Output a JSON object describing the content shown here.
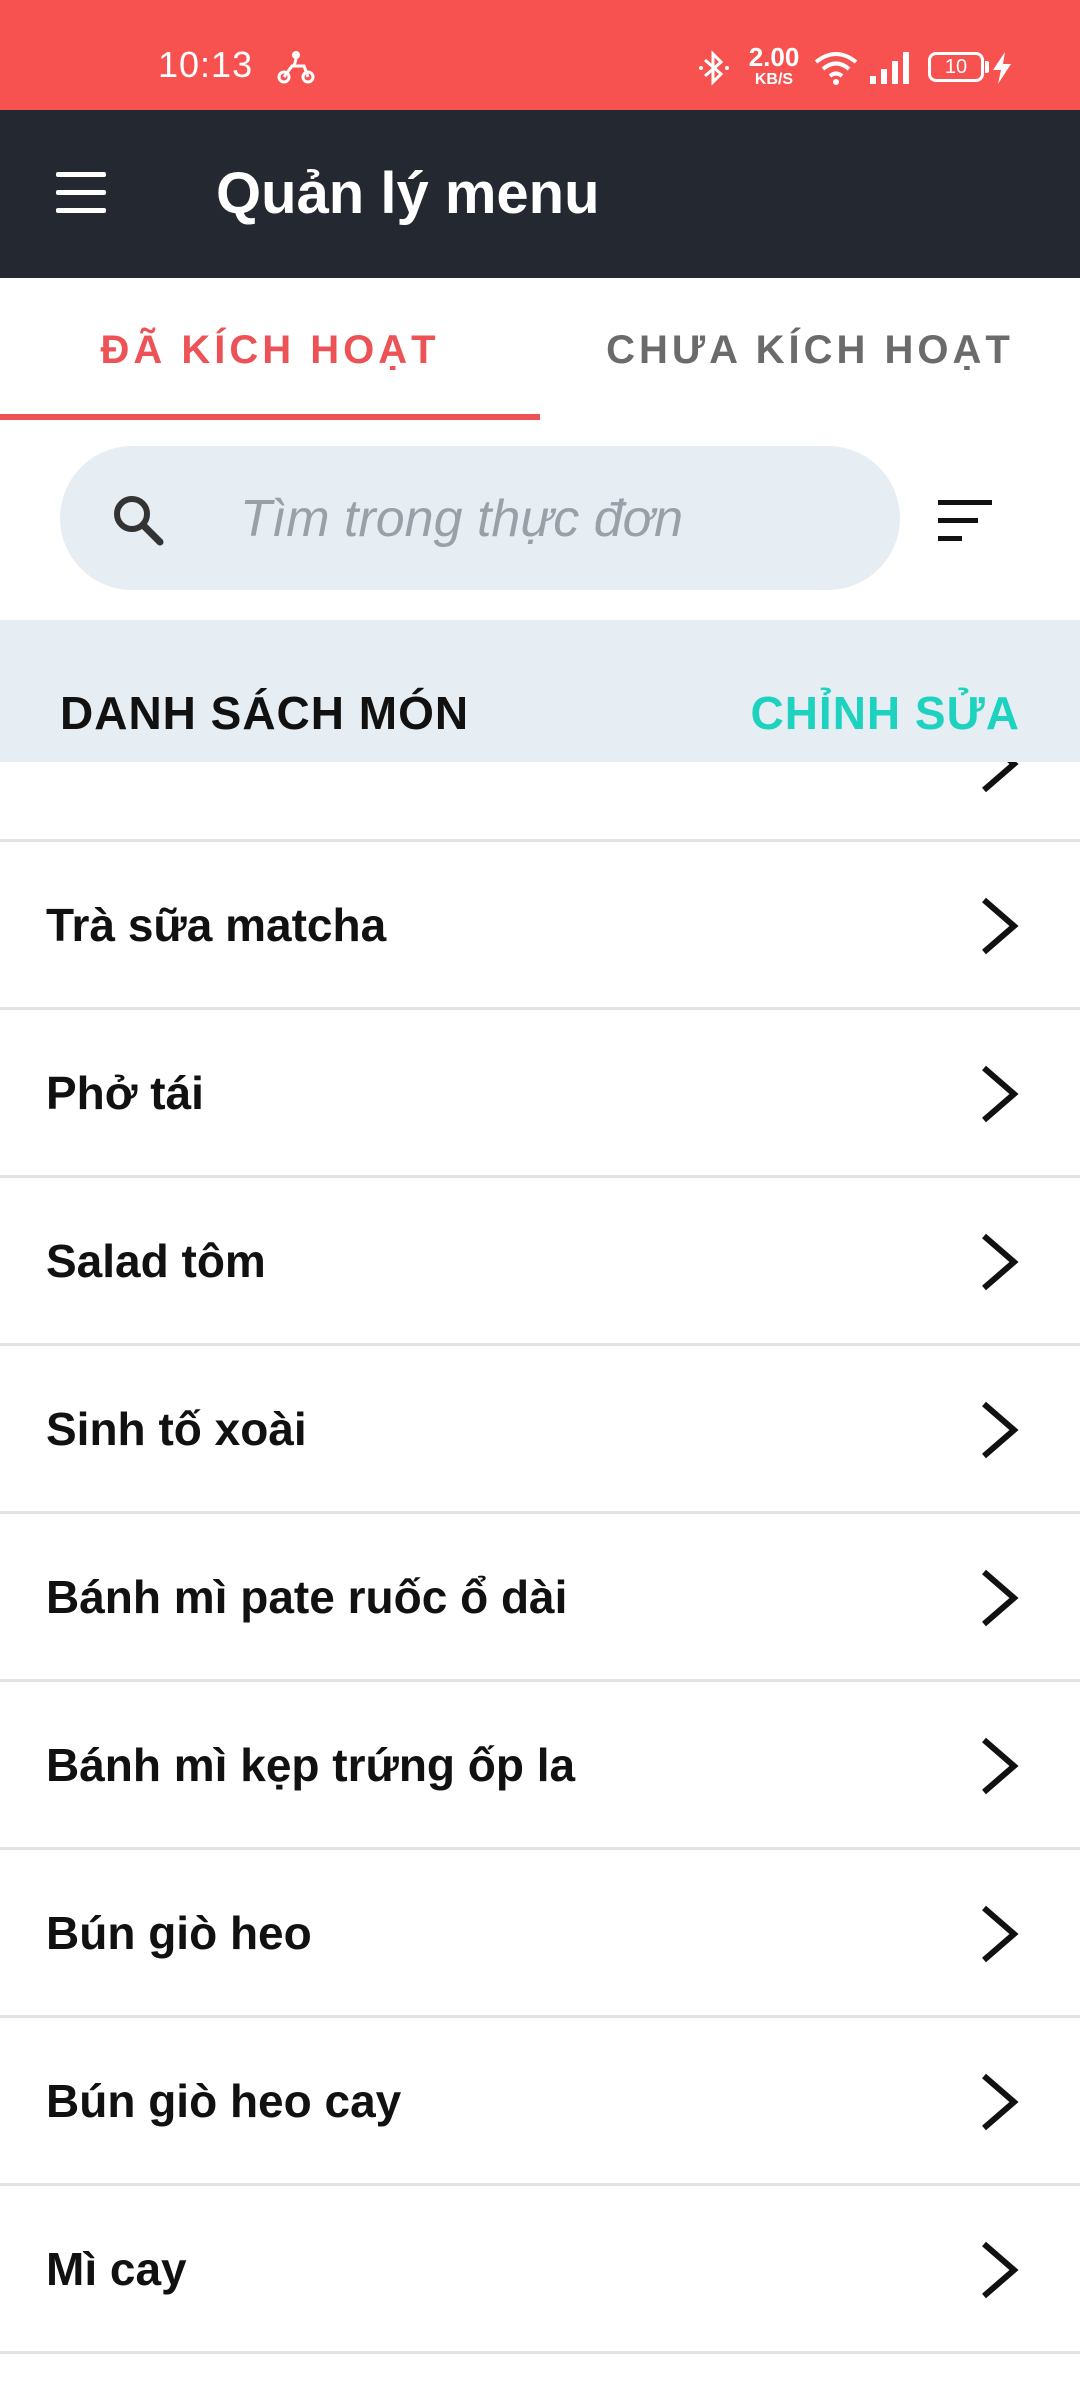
{
  "status_bar": {
    "time": "10:13",
    "net_speed_value": "2.00",
    "net_speed_unit": "KB/S",
    "battery_level": "10",
    "icons": [
      "scooter-icon",
      "bluetooth-icon",
      "wifi-icon",
      "signal-icon",
      "battery-icon",
      "charging-icon"
    ]
  },
  "app_bar": {
    "title": "Quản lý menu",
    "menu_icon": "hamburger-menu-icon"
  },
  "tabs": [
    {
      "label": "ĐÃ KÍCH HOẠT",
      "active": true
    },
    {
      "label": "CHƯA KÍCH HOẠT",
      "active": false
    }
  ],
  "search": {
    "placeholder": "Tìm trong thực đơn",
    "value": ""
  },
  "section": {
    "title": "DANH SÁCH MÓN",
    "action_label": "CHỈNH SỬA"
  },
  "menu_items": [
    "Trà sữa matcha",
    "Phở tái",
    "Salad tôm",
    "Sinh tố xoài",
    "Bánh mì pate ruốc ổ dài",
    "Bánh mì kẹp trứng ốp la",
    "Bún giò heo",
    "Bún giò heo cay",
    "Mì cay"
  ],
  "colors": {
    "status_bar": "#f75150",
    "app_bar": "#242830",
    "accent": "#ec5256",
    "edit_action": "#1ed2c0",
    "search_bg": "#e6edf3"
  }
}
